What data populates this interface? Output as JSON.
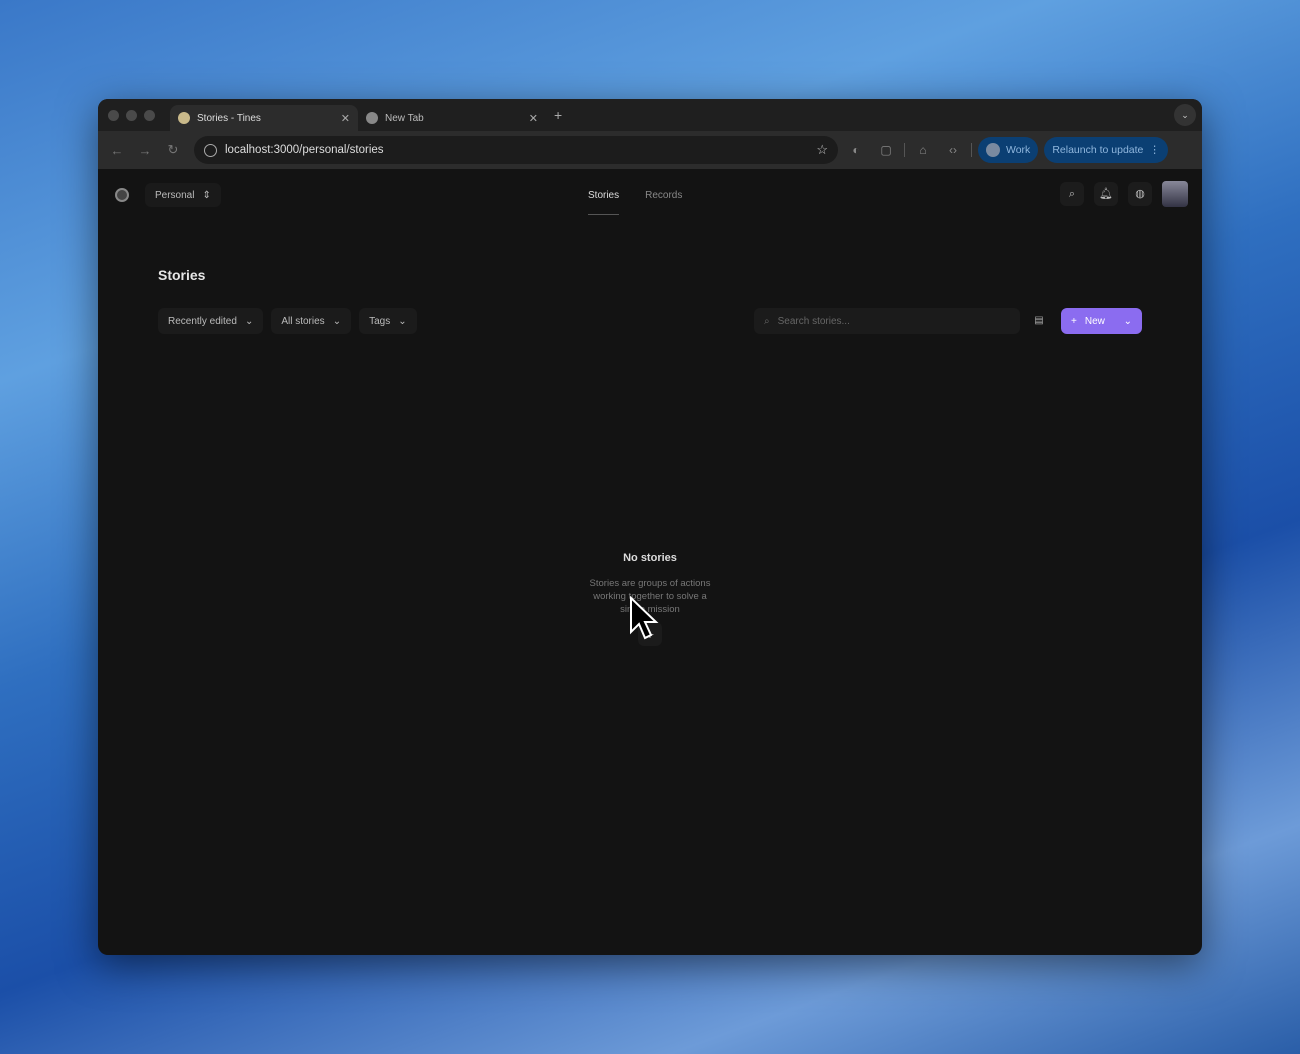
{
  "browser": {
    "tabs": [
      {
        "title": "Stories - Tines",
        "active": true
      },
      {
        "title": "New Tab",
        "active": false
      }
    ],
    "url": "localhost:3000/personal/stories",
    "profile": "Work",
    "update_button": "Relaunch to update"
  },
  "app": {
    "workspace": "Personal",
    "nav": [
      "Stories",
      "Records"
    ],
    "active_nav": "Stories",
    "page_title": "Stories",
    "filters": [
      "Recently edited",
      "All stories",
      "Tags"
    ],
    "search_placeholder": "Search stories...",
    "new_button": "New",
    "empty": {
      "title": "No stories",
      "description": "Stories are groups of actions working together to solve a single mission"
    }
  },
  "colors": {
    "accent": "#8b6cf0",
    "update_pill": "#0b3f73"
  }
}
